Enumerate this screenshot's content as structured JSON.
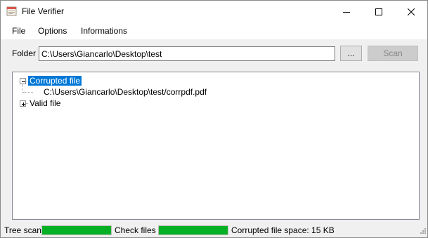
{
  "window": {
    "title": "File Verifier",
    "icon": "file-verifier-app-icon"
  },
  "menu": {
    "items": [
      "File",
      "Options",
      "Informations"
    ]
  },
  "folder": {
    "label": "Folder",
    "value": "C:\\Users\\Giancarlo\\Desktop\\test",
    "browse_label": "...",
    "scan_label": "Scan",
    "scan_enabled": false
  },
  "tree": {
    "nodes": [
      {
        "label": "Corrupted file",
        "expanded": true,
        "selected": true,
        "children": [
          "C:\\Users\\Giancarlo\\Desktop\\test/corrpdf.pdf"
        ]
      },
      {
        "label": "Valid file",
        "expanded": false,
        "selected": false,
        "children": []
      }
    ]
  },
  "status": {
    "tree_scan_label": "Tree scan",
    "tree_scan_progress": 1.0,
    "check_files_label": "Check files",
    "check_files_progress": 1.0,
    "corrupted_space": "Corrupted file space: 15 KB"
  },
  "colors": {
    "selection": "#0078d7",
    "progress": "#06b025"
  }
}
